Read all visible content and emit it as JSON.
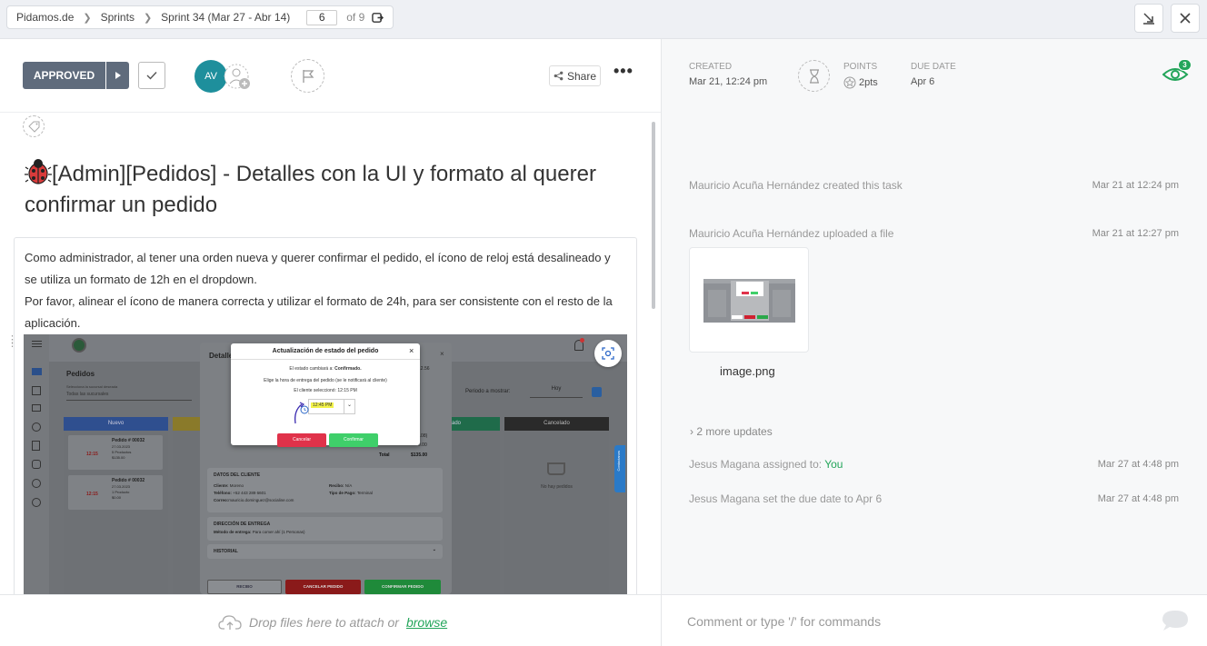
{
  "breadcrumb": {
    "items": [
      "Pidamos.de",
      "Sprints",
      "Sprint 34 (Mar 27 - Abr 14)"
    ],
    "page_value": "6",
    "of_label": "of 9"
  },
  "toolbar": {
    "status_label": "APPROVED",
    "avatar_initials": "AV",
    "share_label": "Share",
    "more_label": "•••"
  },
  "meta": {
    "created_label": "CREATED",
    "created_value": "Mar 21, 12:24 pm",
    "points_label": "POINTS",
    "points_value": "2pts",
    "due_label": "DUE DATE",
    "due_value": "Apr 6",
    "watchers_count": "3"
  },
  "task": {
    "title": "[Admin][Pedidos] - Detalles con la UI y formato al querer confirmar un pedido",
    "description": [
      "Como administrador, al tener una orden nueva y querer confirmar el pedido, el ícono de reloj está desalineado y se utiliza un formato de 12h en el dropdown.",
      "Por favor, alinear el ícono de manera correcta y utilizar el formato de 24h, para ser consistente con el resto de la aplicación."
    ]
  },
  "screenshot": {
    "sidebar_title": "Pedidos",
    "filter_placeholder": "Todas las sucursales",
    "filter_label": "Selecciona la sucursal deseada",
    "period_label": "Periodo a mostrar:",
    "period_value": "Hoy",
    "columns": [
      "Nuevo",
      "Cancelado"
    ],
    "col_entregado": "ado",
    "empty_label": "No hay pedidos",
    "detail_title": "Detalles",
    "order1": {
      "title": "Pedido # 00032",
      "date": "27.03.2023",
      "items": "5 Productos",
      "price": "$135.00",
      "time": "12:15"
    },
    "order2": {
      "title": "Pedido # 00032",
      "date": "27.03.2023",
      "items": "1 Producto",
      "price": "$0.00",
      "time": "12:15"
    },
    "modal": {
      "title": "Actualización de estado del pedido",
      "line1_pre": "El estado cambiará a:",
      "line1_bold": "Confirmado.",
      "line2": "Elige la hora de entrega del pedido (se le notificará al cliente)",
      "line3": "El cliente seleccionó: 12:15 PM",
      "time_value": "12:45 PM",
      "cancel": "Cancelar",
      "confirm": "Confirmar"
    },
    "total_label": "Total",
    "total_value": "$135.00",
    "amount1": "12.56",
    "amount2": "0.00",
    "amount3": "(.08)",
    "client_section": "DATOS DEL CLIENTE",
    "client_name_label": "Cliente:",
    "client_name": "Moreno",
    "client_phone_label": "Teléfono:",
    "client_phone": "+52 443 289 6601",
    "client_email_label": "Correo:",
    "client_email": "mauricio.dominguez@socialine.com",
    "recibo_label": "Recibo:",
    "recibo_value": "N/A",
    "tipo_pago_label": "Tipo de Pago:",
    "tipo_pago_value": "Terminal",
    "address_section": "DIRECCIÓN DE ENTREGA",
    "delivery_label": "Método de entrega:",
    "delivery_value": "Para comer ahí (1 Personas)",
    "history_section": "HISTORIAL",
    "btn_recibo": "RECIBO",
    "btn_cancel": "CANCELAR PEDIDO",
    "btn_confirm": "CONFIRMAR PEDIDO",
    "side_tab": "Contactanos"
  },
  "activity": [
    {
      "text": "Mauricio Acuña Hernández created this task",
      "time": "Mar 21 at 12:24 pm"
    },
    {
      "text": "Mauricio Acuña Hernández uploaded a file",
      "time": "Mar 21 at 12:27 pm"
    }
  ],
  "attachment": {
    "name": "image.png"
  },
  "more_updates": "2 more updates",
  "activity2": [
    {
      "text": "Jesus Magana assigned to:",
      "highlight": "You",
      "time": "Mar 27 at 4:48 pm"
    },
    {
      "text": "Jesus Magana set the due date to Apr 6",
      "time": "Mar 27 at 4:48 pm"
    }
  ],
  "bottom": {
    "drop_text": "Drop files here to attach or",
    "browse_link": "browse",
    "comment_placeholder": "Comment or type '/' for commands"
  },
  "colors": {
    "accent": "#23a55a",
    "avatar": "#1e8f9c",
    "status": "#5f6b7c",
    "bug": "#d93b3b"
  }
}
